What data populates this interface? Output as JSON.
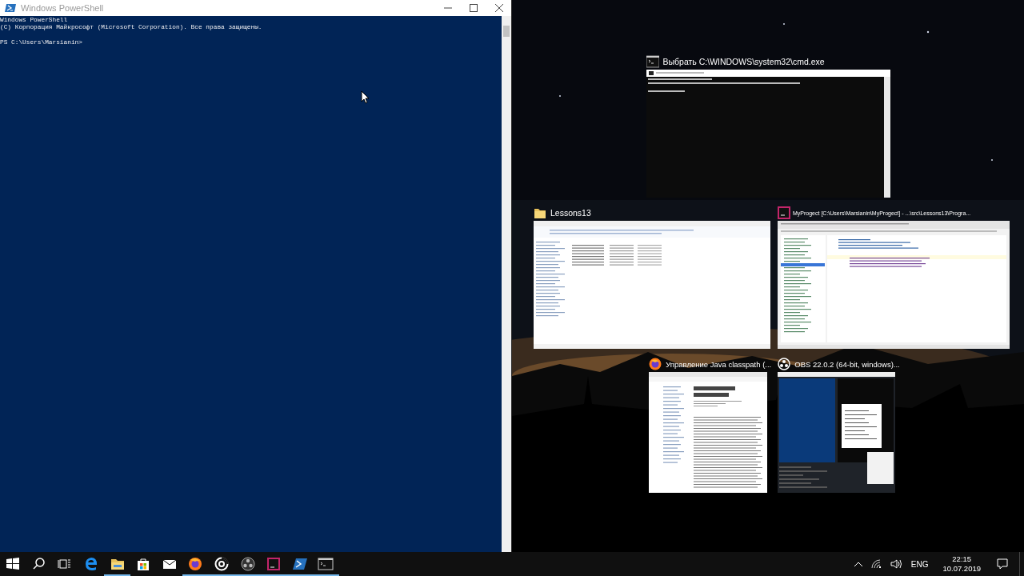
{
  "powershell": {
    "title": "Windows PowerShell",
    "lines": [
      {
        "text": "Windows PowerShell",
        "blank_before": false
      },
      {
        "text": "(C) Корпорация Майкрософт (Microsoft Corporation). Все права защищены.",
        "blank_before": false
      },
      {
        "text": "PS C:\\Users\\Marsianin>",
        "blank_before": true
      }
    ]
  },
  "snap_assist": {
    "rows": [
      [
        {
          "title": "Выбрать C:\\WINDOWS\\system32\\cmd.exe",
          "kind": "console"
        }
      ],
      [
        {
          "title": "Lessons13",
          "kind": "explorer"
        },
        {
          "title": "MyProgect [C:\\Users\\Marsianin\\MyProgect] - ...\\src\\Lessons13\\Progra...",
          "kind": "ide"
        }
      ],
      [
        {
          "title": "Управление Java classpath (...",
          "kind": "browser"
        },
        {
          "title": "OBS 22.0.2 (64-bit, windows)...",
          "kind": "obs"
        }
      ]
    ]
  },
  "taskbar": {
    "items": [
      {
        "kind": "start",
        "running": false
      },
      {
        "kind": "search",
        "running": false
      },
      {
        "kind": "taskview",
        "running": false
      },
      {
        "kind": "edge",
        "running": false
      },
      {
        "kind": "explorer",
        "running": true
      },
      {
        "kind": "store",
        "running": false
      },
      {
        "kind": "mail",
        "running": false
      },
      {
        "kind": "browser",
        "running": true
      },
      {
        "kind": "target",
        "running": true
      },
      {
        "kind": "obs",
        "running": true
      },
      {
        "kind": "ide",
        "running": true
      },
      {
        "kind": "powershell",
        "running": true
      },
      {
        "kind": "console",
        "running": true
      }
    ],
    "language": "ENG",
    "time": "22:15",
    "date": "10.07.2019"
  }
}
